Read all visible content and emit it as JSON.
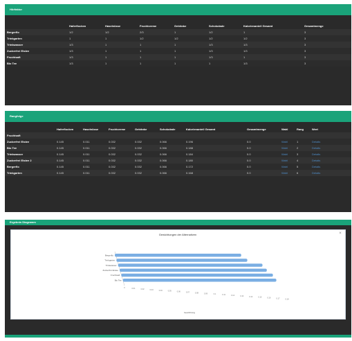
{
  "panel_top": {
    "title": "Hörfaktor",
    "columns": [
      "",
      "Ha­ferflocken",
      "Haselnüsse",
      "Fruchtcreme",
      "Getränke",
      "Schokolade",
      "Kalorienanteil Gesamt",
      "Gesamtmenge"
    ],
    "rows": [
      [
        "Bergerflo",
        "1/2",
        "1/2",
        "2/3",
        "1",
        "1/2",
        "1",
        "3"
      ],
      [
        "Trinkgarten",
        "1",
        "1",
        "1/2",
        "1/2",
        "1/2",
        "1/2",
        "3"
      ],
      [
        "Trinkwasser",
        "1/3",
        "1",
        "1",
        "1",
        "1/3",
        "1/3",
        "3"
      ],
      [
        "Zuckerfrei Eistee",
        "1/3",
        "1",
        "1",
        "1",
        "1/3",
        "1/3",
        "3"
      ],
      [
        "Fruchtsaft",
        "1/3",
        "1",
        "1",
        "1",
        "1/3",
        "1",
        "3"
      ],
      [
        "Bio Tee",
        "1/3",
        "1",
        "1",
        "1",
        "1",
        "1/3",
        "3"
      ]
    ]
  },
  "panel_mid": {
    "title": "Rangfolge",
    "columns": [
      "",
      "Haferflocken",
      "Haselnüsse",
      "Fruchtcreme",
      "Getränke",
      "Schokolade",
      "Kalorienanteil Gesamt",
      "Gesamtmenge",
      "Wahl",
      "Rang",
      "Wert"
    ],
    "rows": [
      [
        "Fruchtsaft",
        "",
        "",
        "",
        "",
        "",
        "",
        "",
        "",
        "",
        ""
      ],
      [
        "Zuckerfrei Eistee",
        "0.145",
        "0.011",
        "0.032",
        "0.032",
        "0.066",
        "0.196",
        "0.0",
        "Wahl",
        "1",
        "Details"
      ],
      [
        "Bio Tee",
        "0.145",
        "0.011",
        "0.032",
        "0.032",
        "0.066",
        "0.188",
        "0.0",
        "Wahl",
        "2",
        "Details"
      ],
      [
        "Trinkwasser",
        "0.145",
        "0.011",
        "0.032",
        "0.032",
        "0.066",
        "0.184",
        "0.0",
        "Wahl",
        "3",
        "Details"
      ],
      [
        "Zuckerfrei Eistee 2",
        "0.145",
        "0.011",
        "0.032",
        "0.032",
        "0.066",
        "0.180",
        "0.0",
        "Wahl",
        "4",
        "Details"
      ],
      [
        "Bergerflo",
        "0.145",
        "0.011",
        "0.032",
        "0.032",
        "0.066",
        "0.172",
        "0.0",
        "Wahl",
        "5",
        "Details"
      ],
      [
        "Trinkgarten",
        "0.145",
        "0.011",
        "0.032",
        "0.032",
        "0.066",
        "0.168",
        "0.0",
        "Wahl",
        "6",
        "Details"
      ]
    ]
  },
  "panel_chart": {
    "title": "Ergebnis Diagramm",
    "close_icon": "×"
  },
  "chart_data": {
    "type": "bar",
    "orientation": "horizontal",
    "title": "Gewichtungen der Alternativen",
    "xlabel": "Gewichtung",
    "ylabel": "",
    "categories": [
      "Bergerflo",
      "Trinkgarten",
      "Trinkwasser",
      "Zuckerfrei Eistee",
      "Fruchtsaft",
      "Bio Tee"
    ],
    "values": [
      0.14,
      0.145,
      0.16,
      0.163,
      0.168,
      0.17
    ],
    "xlim": [
      0,
      0.18
    ],
    "ticks": [
      "0",
      "0.01",
      "0.02",
      "0.03",
      "0.04",
      "0.05",
      "0.06",
      "0.07",
      "0.08",
      "0.09",
      "0.1",
      "0.11",
      "0.12",
      "0.13",
      "0.14",
      "0.15",
      "0.16",
      "0.17",
      "0.18"
    ],
    "bar_color": "#7aaee3",
    "grid": true
  },
  "colors": {
    "accent": "#1aa37a",
    "panel_bg": "#2a2a2a",
    "link": "#4e8cc7"
  }
}
